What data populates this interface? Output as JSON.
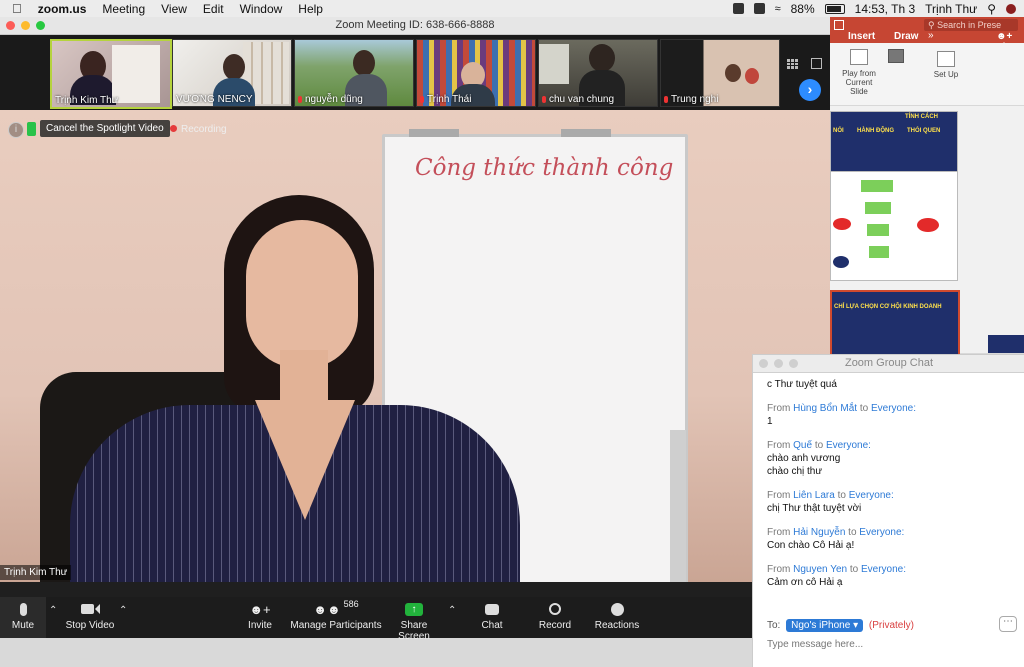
{
  "menubar": {
    "app": "zoom.us",
    "items": [
      "Meeting",
      "View",
      "Edit",
      "Window",
      "Help"
    ],
    "battery": "88%",
    "clock": "14:53, Th 3",
    "user": "Trịnh Thư"
  },
  "zoom": {
    "title": "Zoom Meeting ID: 638-666-8888",
    "thumbnails": [
      {
        "name": "Trịnh Kim Thư"
      },
      {
        "name": "VƯƠNG NENCY"
      },
      {
        "name": "nguyễn dũng"
      },
      {
        "name": "Trịnh Thái"
      },
      {
        "name": "chu van chung"
      },
      {
        "name": "Trung nghi"
      }
    ],
    "spotlight_button": "Cancel the Spotlight Video",
    "recording": "Recording",
    "speaker_name": "Trịnh Kim Thư",
    "whiteboard_text": "Công thức thành công",
    "toolbar": {
      "mute": "Mute",
      "stop_video": "Stop Video",
      "invite": "Invite",
      "manage_participants": "Manage Participants",
      "participant_count": "586",
      "share_screen": "Share Screen",
      "chat": "Chat",
      "record": "Record",
      "reactions": "Reactions"
    }
  },
  "ppt": {
    "search_placeholder": "Search in Prese",
    "tabs": [
      "Insert",
      "Draw"
    ],
    "share": "Sh",
    "play_from": "Play from Current Slide",
    "setup": "Set Up",
    "slide1_words": [
      "TÍNH CÁCH",
      "NÓI",
      "HÀNH ĐỘNG",
      "THÓI QUEN"
    ],
    "slide3_title": "CHỈ LỰA CHỌN CƠ HỘI KINH DOANH"
  },
  "chat": {
    "title": "Zoom Group Chat",
    "messages": [
      {
        "from": "",
        "to": "",
        "text": [
          "c Thư tuyệt quá"
        ],
        "partial": true
      },
      {
        "from": "Hùng Bổn Mắt",
        "to": "Everyone:",
        "text": [
          "1"
        ]
      },
      {
        "from": "Quế",
        "to": "Everyone:",
        "text": [
          "chào anh vương",
          "chào chị thư"
        ]
      },
      {
        "from": "Liên Lara",
        "to": "Everyone:",
        "text": [
          "chị Thư thật tuyệt vời"
        ]
      },
      {
        "from": "Hải Nguyễn",
        "to": "Everyone:",
        "text": [
          "Con chào Cô Hải ạ!"
        ]
      },
      {
        "from": "Nguyen Yen",
        "to": "Everyone:",
        "text": [
          "Cảm ơn cô Hải ạ"
        ]
      }
    ],
    "from_label": "From",
    "to_label": "to",
    "to_prefix": "To:",
    "recipient": "Ngo's iPhone",
    "privately": "(Privately)",
    "placeholder": "Type message here..."
  }
}
